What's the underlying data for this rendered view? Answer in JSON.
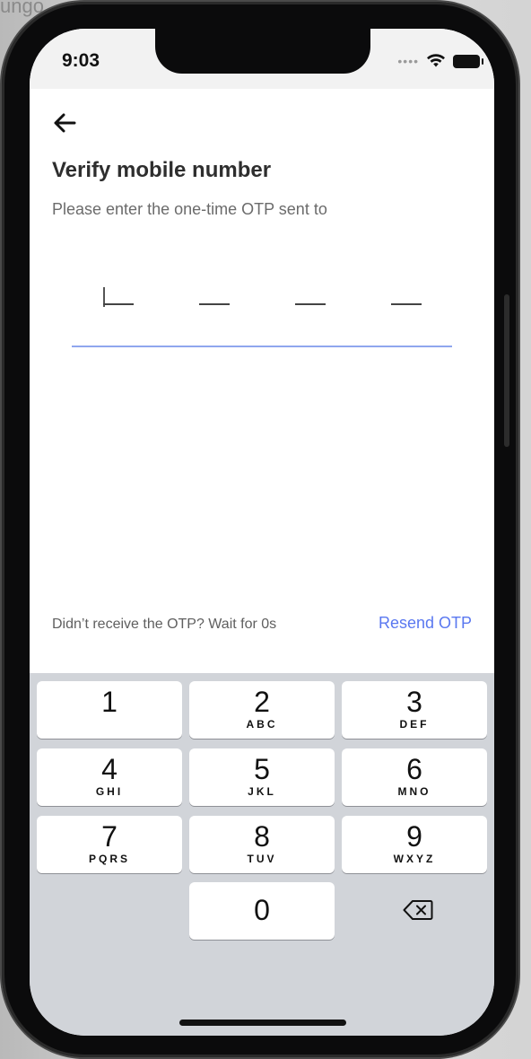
{
  "backdrop": {
    "fragment": "ungo"
  },
  "status_bar": {
    "time": "9:03",
    "signal_dots": "••••"
  },
  "header": {
    "title": "Verify mobile number",
    "subtitle": "Please enter the one-time OTP sent to"
  },
  "otp": {
    "digit_count": 4,
    "accent": "#8fa6ee"
  },
  "footer": {
    "hint": "Didn’t receive the OTP? Wait for 0s",
    "resend_label": "Resend OTP",
    "resend_color": "#5a78f0"
  },
  "keypad": {
    "keys": [
      {
        "digit": "1",
        "letters": ""
      },
      {
        "digit": "2",
        "letters": "ABC"
      },
      {
        "digit": "3",
        "letters": "DEF"
      },
      {
        "digit": "4",
        "letters": "GHI"
      },
      {
        "digit": "5",
        "letters": "JKL"
      },
      {
        "digit": "6",
        "letters": "MNO"
      },
      {
        "digit": "7",
        "letters": "PQRS"
      },
      {
        "digit": "8",
        "letters": "TUV"
      },
      {
        "digit": "9",
        "letters": "WXYZ"
      },
      {
        "digit": "0",
        "letters": ""
      }
    ],
    "delete_icon": "backspace-icon"
  }
}
